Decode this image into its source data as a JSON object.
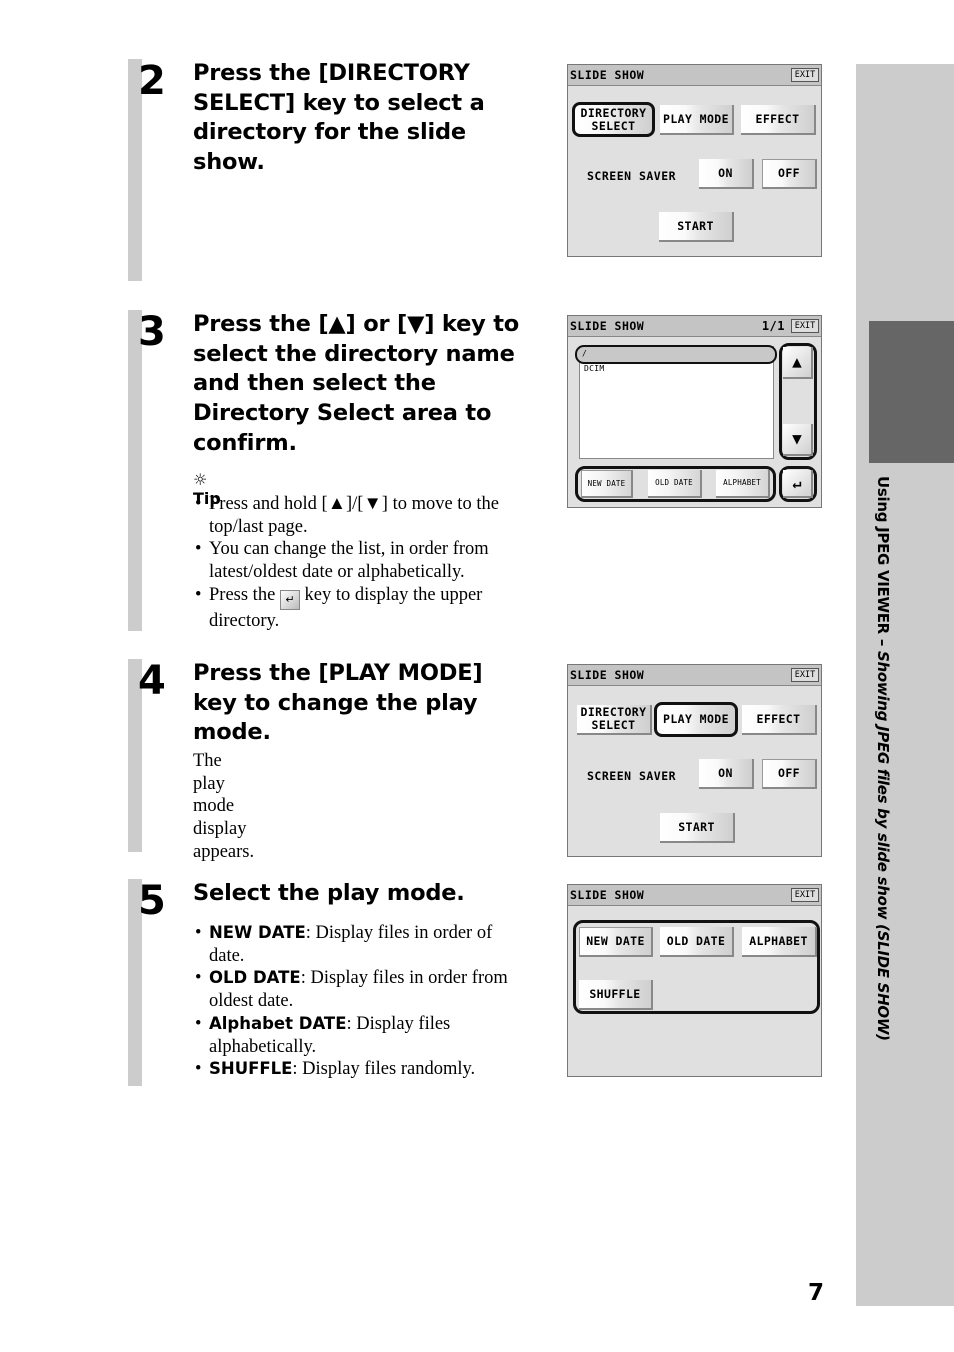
{
  "sidebar": {
    "section_title_bold": "Using JPEG VIEWER – ",
    "section_title_italic": "Showing JPEG files by slide show (SLIDE SHOW)"
  },
  "page_number": "7",
  "steps": [
    {
      "number": "2",
      "title": "Press the [DIRECTORY SELECT] key to select a directory for the slide show."
    },
    {
      "number": "3",
      "title": "Press the [▲] or [▼] key to select the directory name and then select the Directory Select area to confirm.",
      "tip_label": "Tip",
      "tips": [
        "Press and hold [▲]/[▼] to move to the top/last page.",
        "You can change the list, in order from latest/oldest date or alphabetically."
      ],
      "tip3_before": "Press the ",
      "tip3_after": " key to display the upper directory.",
      "tip3_key_glyph": "↵"
    },
    {
      "number": "4",
      "title": "Press the [PLAY MODE] key to change the play mode.",
      "body": "The play mode display appears."
    },
    {
      "number": "5",
      "title": "Select the play mode.",
      "items": [
        {
          "term": "NEW DATE",
          "desc": ": Display files in order of date."
        },
        {
          "term": "OLD DATE",
          "desc": ": Display files in order from oldest date."
        },
        {
          "term": "Alphabet DATE",
          "desc": ": Display files alphabetically."
        },
        {
          "term": "SHUFFLE",
          "desc": ": Display files randomly."
        }
      ]
    }
  ],
  "screens": {
    "main1": {
      "title": "SLIDE SHOW",
      "exit": "EXIT",
      "directory_select": "DIRECTORY SELECT",
      "play_mode": "PLAY MODE",
      "effect": "EFFECT",
      "screen_saver_label": "SCREEN SAVER",
      "on": "ON",
      "off": "OFF",
      "start": "START",
      "selected": "DIRECTORY SELECT"
    },
    "dirlist": {
      "title": "SLIDE SHOW",
      "page": "1/1",
      "exit": "EXIT",
      "rows": [
        "/",
        "DCIM"
      ],
      "selected_row": "/",
      "up_glyph": "▲",
      "down_glyph": "▼",
      "back_glyph": "↵",
      "sort_buttons": [
        "NEW DATE",
        "OLD DATE",
        "ALPHABET"
      ]
    },
    "main2": {
      "title": "SLIDE SHOW",
      "exit": "EXIT",
      "directory_select": "DIRECTORY SELECT",
      "play_mode": "PLAY MODE",
      "effect": "EFFECT",
      "screen_saver_label": "SCREEN SAVER",
      "on": "ON",
      "off": "OFF",
      "start": "START",
      "selected": "PLAY MODE"
    },
    "playmode": {
      "title": "SLIDE SHOW",
      "exit": "EXIT",
      "new_date": "NEW DATE",
      "old_date": "OLD DATE",
      "alphabet": "ALPHABET",
      "shuffle": "SHUFFLE"
    }
  }
}
